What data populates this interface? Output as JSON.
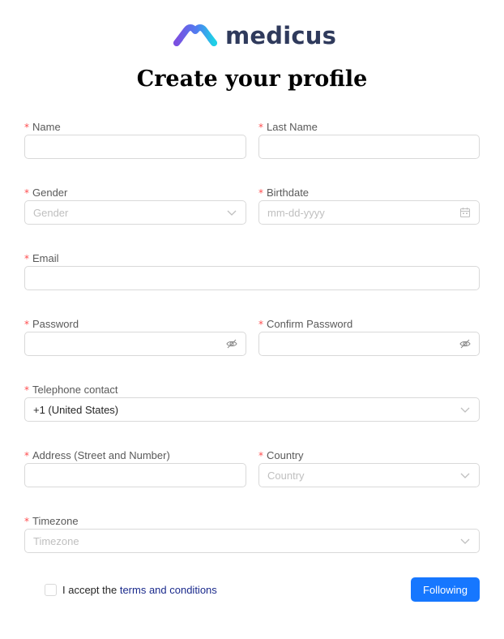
{
  "brand": {
    "name": "medicus"
  },
  "page": {
    "title": "Create your profile"
  },
  "form": {
    "name": {
      "label": "Name",
      "value": ""
    },
    "last_name": {
      "label": "Last Name",
      "value": ""
    },
    "gender": {
      "label": "Gender",
      "placeholder": "Gender"
    },
    "birthdate": {
      "label": "Birthdate",
      "placeholder": "mm-dd-yyyy"
    },
    "email": {
      "label": "Email",
      "value": ""
    },
    "password": {
      "label": "Password",
      "value": ""
    },
    "confirm_password": {
      "label": "Confirm Password",
      "value": ""
    },
    "telephone": {
      "label": "Telephone contact",
      "value": "+1 (United States)"
    },
    "address": {
      "label": "Address (Street and Number)",
      "value": ""
    },
    "country": {
      "label": "Country",
      "placeholder": "Country"
    },
    "timezone": {
      "label": "Timezone",
      "placeholder": "Timezone"
    },
    "required_mark": "*"
  },
  "footer": {
    "accept_prefix": "I accept the ",
    "terms_link": "terms and conditions",
    "terms_checked": false,
    "submit_label": "Following"
  },
  "colors": {
    "primary": "#1677ff",
    "required": "#ff4d4f",
    "border": "#d9d9d9",
    "placeholder": "#bfbfbf",
    "link": "#1a2a8c",
    "logo_text": "#2f3a5c"
  },
  "icons": {
    "brand": "medicus-logo-icon",
    "select": "chevron-down-icon",
    "calendar": "calendar-icon",
    "password_toggle": "eye-invisible-icon"
  }
}
